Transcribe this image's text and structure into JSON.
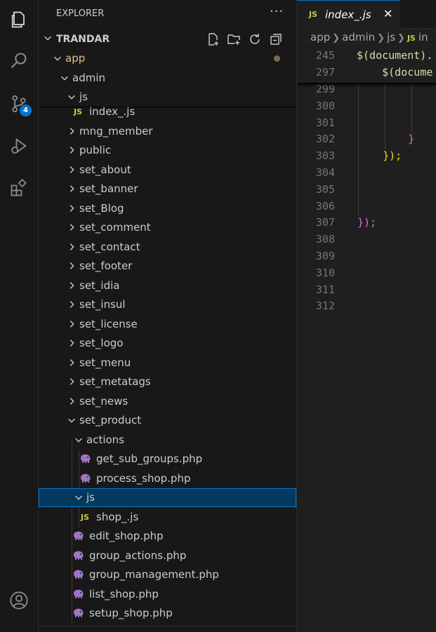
{
  "explorer": {
    "title": "EXPLORER",
    "more": "···",
    "project": "TRANDAR",
    "tools": [
      "new-file-icon",
      "new-folder-icon",
      "refresh-icon",
      "collapse-all-icon"
    ]
  },
  "activity_bar": {
    "scm_badge": "4"
  },
  "tree": [
    {
      "label": "app",
      "type": "folder",
      "expanded": true
    },
    {
      "label": "admin",
      "type": "folder",
      "expanded": true
    },
    {
      "label": "js",
      "type": "folder",
      "expanded": true
    },
    {
      "label": "index_.js",
      "type": "js"
    },
    {
      "label": "mng_member",
      "type": "folder"
    },
    {
      "label": "public",
      "type": "folder"
    },
    {
      "label": "set_about",
      "type": "folder"
    },
    {
      "label": "set_banner",
      "type": "folder"
    },
    {
      "label": "set_Blog",
      "type": "folder"
    },
    {
      "label": "set_comment",
      "type": "folder"
    },
    {
      "label": "set_contact",
      "type": "folder"
    },
    {
      "label": "set_footer",
      "type": "folder"
    },
    {
      "label": "set_idia",
      "type": "folder"
    },
    {
      "label": "set_insul",
      "type": "folder"
    },
    {
      "label": "set_license",
      "type": "folder"
    },
    {
      "label": "set_logo",
      "type": "folder"
    },
    {
      "label": "set_menu",
      "type": "folder"
    },
    {
      "label": "set_metatags",
      "type": "folder"
    },
    {
      "label": "set_news",
      "type": "folder"
    },
    {
      "label": "set_product",
      "type": "folder",
      "expanded": true
    },
    {
      "label": "actions",
      "type": "folder",
      "expanded": true
    },
    {
      "label": "get_sub_groups.php",
      "type": "php"
    },
    {
      "label": "process_shop.php",
      "type": "php"
    },
    {
      "label": "js",
      "type": "folder",
      "expanded": true,
      "selected": true
    },
    {
      "label": "shop_.js",
      "type": "js"
    },
    {
      "label": "edit_shop.php",
      "type": "php"
    },
    {
      "label": "group_actions.php",
      "type": "php"
    },
    {
      "label": "group_management.php",
      "type": "php"
    },
    {
      "label": "list_shop.php",
      "type": "php"
    },
    {
      "label": "setup_shop.php",
      "type": "php"
    }
  ],
  "editor": {
    "tab": {
      "icon_text": "JS",
      "name": "index_.js",
      "close": "✕"
    },
    "breadcrumbs": [
      "app",
      "admin",
      "js"
    ],
    "breadcrumb_file_icon": "JS",
    "breadcrumb_file_partial": "in",
    "sticky": [
      {
        "line": "245",
        "code": "$(document)."
      },
      {
        "line": "297",
        "code": "    $(docume"
      }
    ],
    "lines": [
      {
        "line": "299",
        "code": ""
      },
      {
        "line": "300",
        "code": ""
      },
      {
        "line": "301",
        "code": ""
      },
      {
        "line": "302",
        "code": "        }"
      },
      {
        "line": "303",
        "code": "    });"
      },
      {
        "line": "304",
        "code": ""
      },
      {
        "line": "305",
        "code": ""
      },
      {
        "line": "306",
        "code": ""
      },
      {
        "line": "307",
        "code": "});"
      },
      {
        "line": "308",
        "code": ""
      },
      {
        "line": "309",
        "code": ""
      },
      {
        "line": "310",
        "code": ""
      },
      {
        "line": "311",
        "code": ""
      },
      {
        "line": "312",
        "code": ""
      }
    ]
  },
  "colors": {
    "folder_text": "#cccccc",
    "app_folder": "#e2c08d",
    "js_icon": "#cbcb41",
    "php_icon": "#a074c4",
    "selection": "#04395e",
    "focus": "#0078d4"
  }
}
